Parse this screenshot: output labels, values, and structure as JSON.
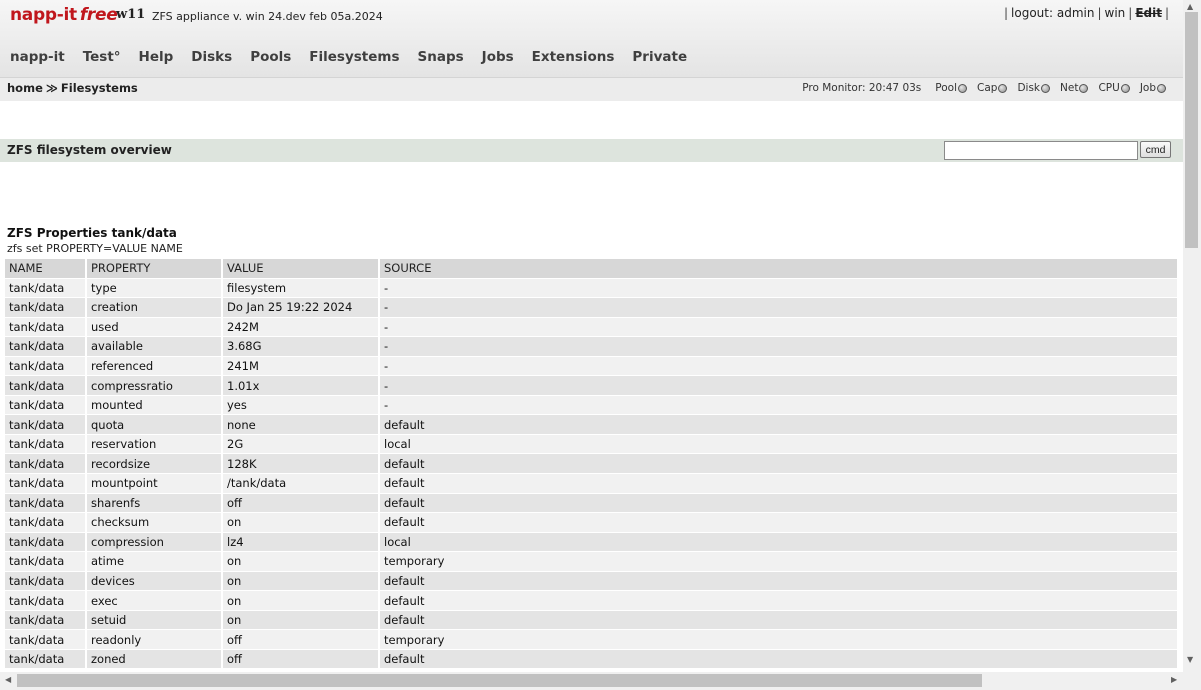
{
  "header": {
    "brand": "napp-it",
    "brand_edition": "free",
    "host": "w11",
    "version": "ZFS appliance v. win 24.dev feb 05a.2024",
    "user_links": {
      "logout": "logout: admin",
      "os": "win",
      "edit": "Edit"
    }
  },
  "nav": {
    "items": [
      {
        "label": "napp-it"
      },
      {
        "label": "Test°"
      },
      {
        "label": "Help"
      },
      {
        "label": "Disks"
      },
      {
        "label": "Pools"
      },
      {
        "label": "Filesystems"
      },
      {
        "label": "Snaps"
      },
      {
        "label": "Jobs"
      },
      {
        "label": "Extensions"
      },
      {
        "label": "Private"
      }
    ]
  },
  "breadcrumb": {
    "home": "home",
    "separator": "≫",
    "current": "Filesystems"
  },
  "monitor": {
    "label": "Pro Monitor: 20:47 03s",
    "items": [
      "Pool",
      "Cap",
      "Disk",
      "Net",
      "CPU",
      "Job"
    ]
  },
  "section": {
    "title": "ZFS filesystem overview",
    "cmd_value": "",
    "cmd_button": "cmd"
  },
  "properties": {
    "title": "ZFS Properties tank/data",
    "command": "zfs set PROPERTY=VALUE NAME",
    "headers": [
      "NAME",
      "PROPERTY",
      "VALUE",
      "SOURCE"
    ],
    "rows": [
      [
        "tank/data",
        "type",
        "filesystem",
        "-"
      ],
      [
        "tank/data",
        "creation",
        "Do Jan 25 19:22 2024",
        "-"
      ],
      [
        "tank/data",
        "used",
        "242M",
        "-"
      ],
      [
        "tank/data",
        "available",
        "3.68G",
        "-"
      ],
      [
        "tank/data",
        "referenced",
        "241M",
        "-"
      ],
      [
        "tank/data",
        "compressratio",
        "1.01x",
        "-"
      ],
      [
        "tank/data",
        "mounted",
        "yes",
        "-"
      ],
      [
        "tank/data",
        "quota",
        "none",
        "default"
      ],
      [
        "tank/data",
        "reservation",
        "2G",
        "local"
      ],
      [
        "tank/data",
        "recordsize",
        "128K",
        "default"
      ],
      [
        "tank/data",
        "mountpoint",
        "/tank/data",
        "default"
      ],
      [
        "tank/data",
        "sharenfs",
        "off",
        "default"
      ],
      [
        "tank/data",
        "checksum",
        "on",
        "default"
      ],
      [
        "tank/data",
        "compression",
        "lz4",
        "local"
      ],
      [
        "tank/data",
        "atime",
        "on",
        "temporary"
      ],
      [
        "tank/data",
        "devices",
        "on",
        "default"
      ],
      [
        "tank/data",
        "exec",
        "on",
        "default"
      ],
      [
        "tank/data",
        "setuid",
        "on",
        "default"
      ],
      [
        "tank/data",
        "readonly",
        "off",
        "temporary"
      ],
      [
        "tank/data",
        "zoned",
        "off",
        "default"
      ]
    ]
  },
  "colors": {
    "brand": "#c0161c",
    "section_bg": "#dde4dd",
    "row_odd": "#f1f1f1",
    "row_even": "#e4e4e4"
  }
}
